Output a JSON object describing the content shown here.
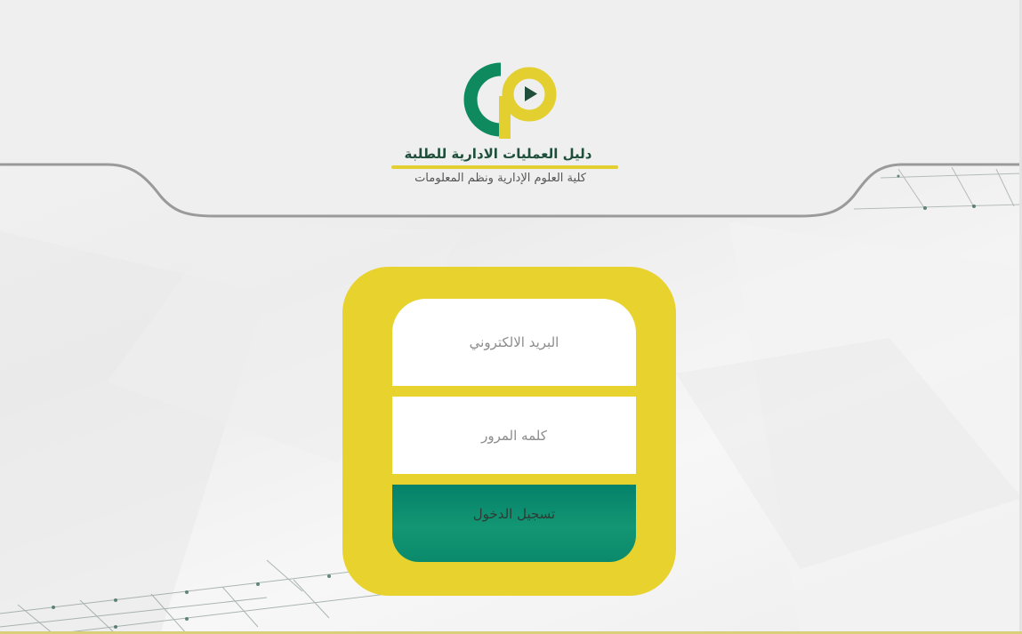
{
  "header": {
    "title": "دليل العمليات الادارية للطلبة",
    "subtitle": "كلية العلوم الإدارية ونظم المعلومات",
    "logo_icon": "play-logo-icon"
  },
  "login": {
    "email_placeholder": "البريد الالكتروني",
    "email_value": "",
    "password_placeholder": "كلمه المرور",
    "password_value": "",
    "submit_label": "تسجيل الدخول"
  },
  "colors": {
    "accent_yellow": "#e7d22e",
    "brand_green": "#0a8a6b",
    "title_green": "#1f4f3a"
  }
}
